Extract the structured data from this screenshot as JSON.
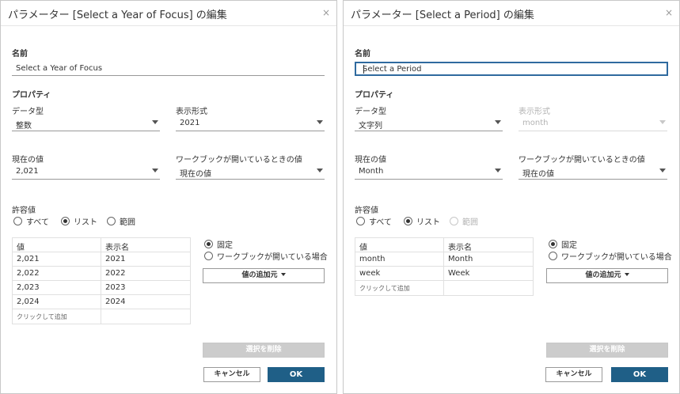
{
  "dialogs": [
    {
      "title": "パラメーター [Select a Year of Focus] の編集",
      "close": "×",
      "name_label": "名前",
      "name_value": "Select a Year of Focus",
      "properties_label": "プロパティ",
      "data_type_label": "データ型",
      "data_type_value": "整数",
      "display_format_label": "表示形式",
      "display_format_value": "2021",
      "current_value_label": "現在の値",
      "current_value": "2,021",
      "workbook_open_label": "ワークブックが開いているときの値",
      "workbook_open_value": "現在の値",
      "allowable_label": "許容値",
      "allowable_options": [
        "すべて",
        "リスト",
        "範囲"
      ],
      "allowable_selected": "リスト",
      "table_headers": [
        "値",
        "表示名"
      ],
      "table_rows": [
        [
          "2,021",
          "2021"
        ],
        [
          "2,022",
          "2022"
        ],
        [
          "2,023",
          "2023"
        ],
        [
          "2,024",
          "2024"
        ]
      ],
      "click_to_add": "クリックして追加",
      "source_options": [
        "固定",
        "ワークブックが開いている場合"
      ],
      "source_selected": "固定",
      "add_values_button": "値の追加元",
      "clear_button": "選択を削除",
      "cancel_button": "キャンセル",
      "ok_button": "OK"
    },
    {
      "title": "パラメーター [Select a Period] の編集",
      "close": "×",
      "name_label": "名前",
      "name_value": "Select a Period",
      "properties_label": "プロパティ",
      "data_type_label": "データ型",
      "data_type_value": "文字列",
      "display_format_label": "表示形式",
      "display_format_value": "month",
      "current_value_label": "現在の値",
      "current_value": "Month",
      "workbook_open_label": "ワークブックが開いているときの値",
      "workbook_open_value": "現在の値",
      "allowable_label": "許容値",
      "allowable_options": [
        "すべて",
        "リスト",
        "範囲"
      ],
      "allowable_selected": "リスト",
      "table_headers": [
        "値",
        "表示名"
      ],
      "table_rows": [
        [
          "month",
          "Month"
        ],
        [
          "week",
          "Week"
        ]
      ],
      "click_to_add": "クリックして追加",
      "source_options": [
        "固定",
        "ワークブックが開いている場合"
      ],
      "source_selected": "固定",
      "add_values_button": "値の追加元",
      "clear_button": "選択を削除",
      "cancel_button": "キャンセル",
      "ok_button": "OK"
    }
  ]
}
